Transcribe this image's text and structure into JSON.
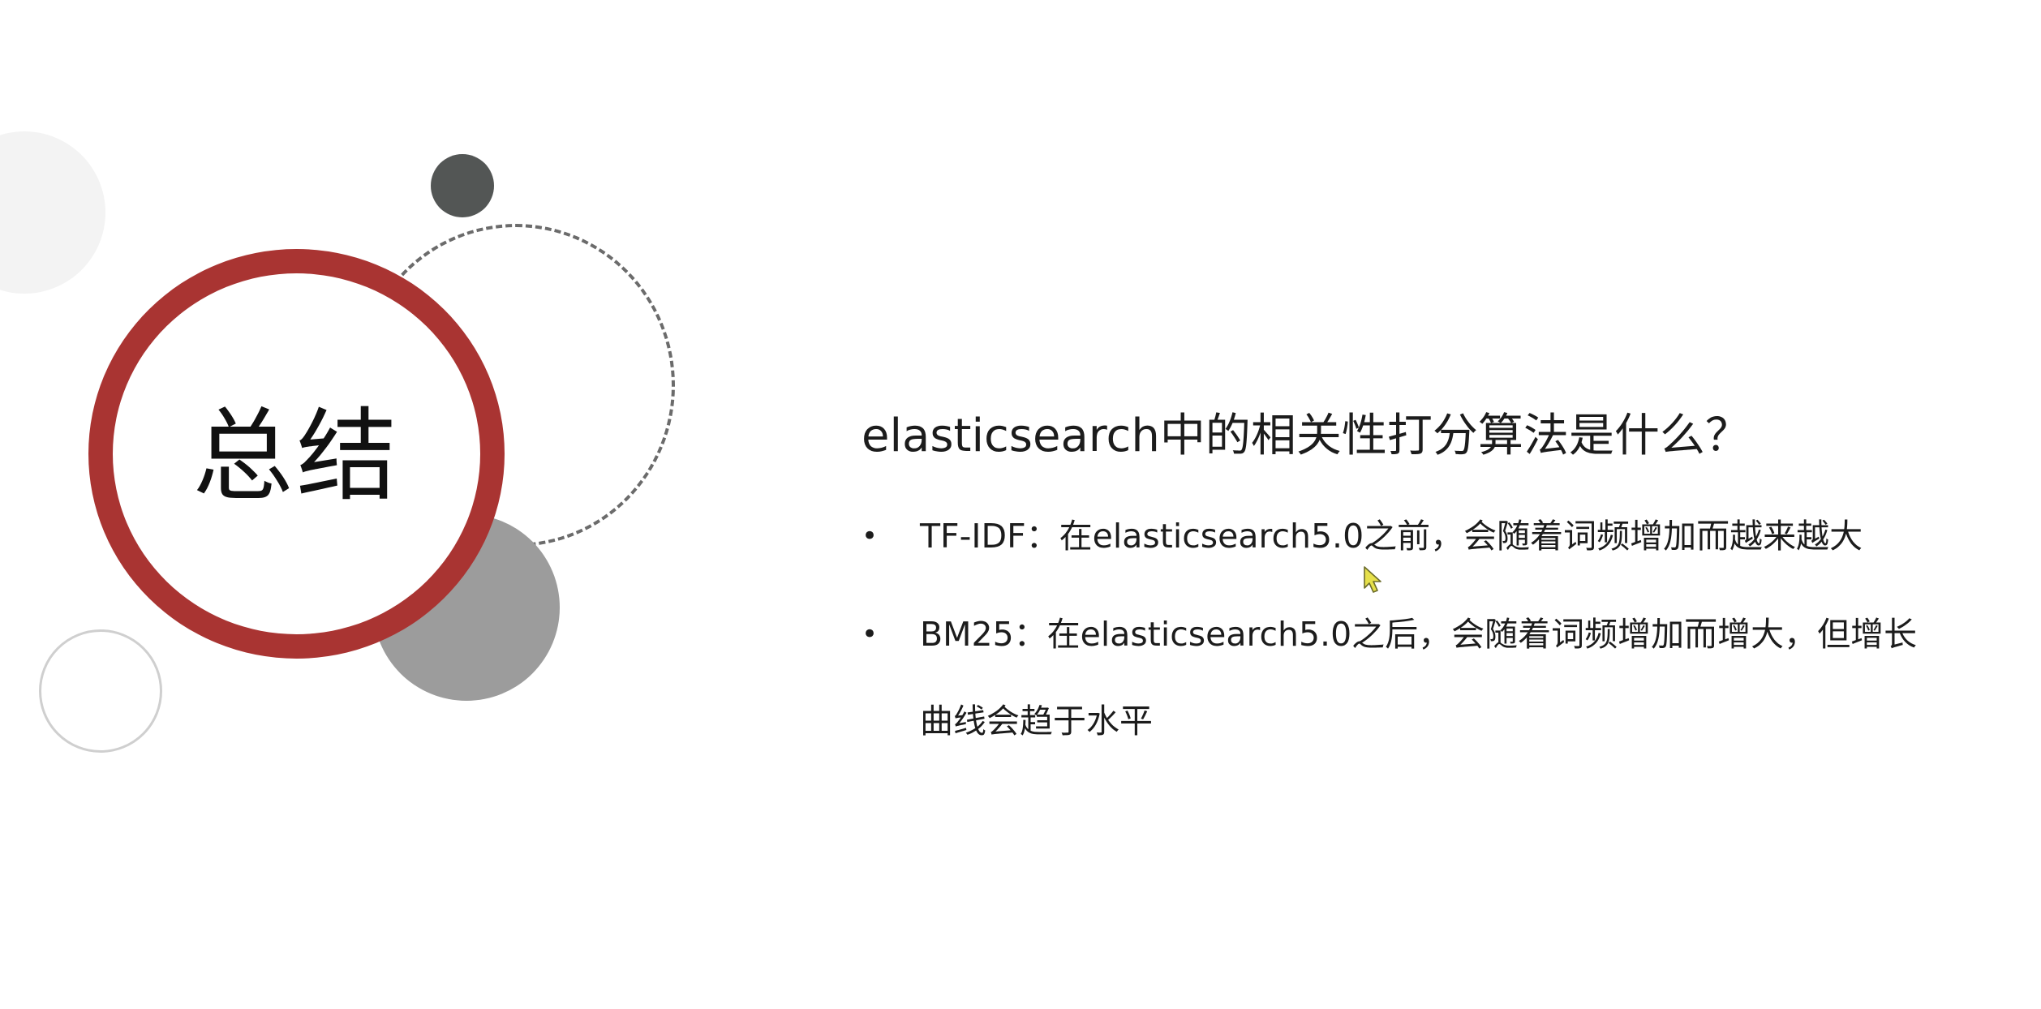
{
  "slide": {
    "title": "总结",
    "question": "elasticsearch中的相关性打分算法是什么？",
    "bullet_symbol": "•",
    "bullets": [
      {
        "text": "TF-IDF：在elasticsearch5.0之前，会随着词频增加而越来越大"
      },
      {
        "text": "BM25：在elasticsearch5.0之后，会随着词频增加而增大，但增长",
        "continuation": "曲线会趋于水平"
      }
    ]
  },
  "colors": {
    "accent_red": "#a93432",
    "dark_gray": "#535655",
    "mid_gray": "#9c9c9c",
    "light_gray": "#f3f3f3"
  },
  "cursor": {
    "icon": "mouse-pointer-icon",
    "color": "#e6e04a"
  }
}
